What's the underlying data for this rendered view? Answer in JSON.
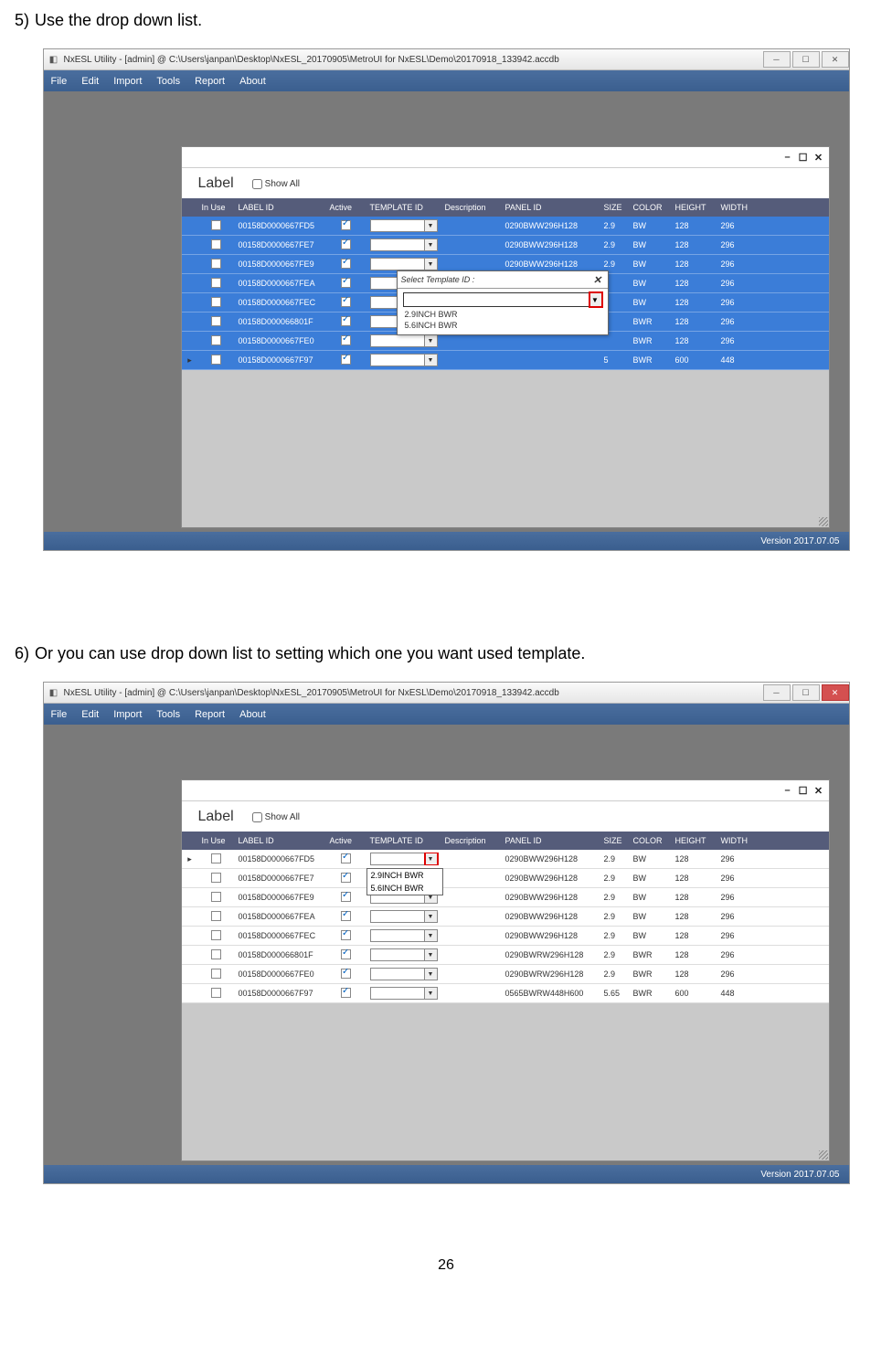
{
  "step5_text": "Use the drop down list.",
  "step5_num": "5)",
  "step6_text": "Or you can use drop down list to setting which one you want used template.",
  "step6_num": "6)",
  "page_number": "26",
  "app": {
    "title": "NxESL Utility - [admin] @ C:\\Users\\janpan\\Desktop\\NxESL_20170905\\MetroUI for NxESL\\Demo\\20170918_133942.accdb",
    "menu": [
      "File",
      "Edit",
      "Import",
      "Tools",
      "Report",
      "About"
    ],
    "version": "Version 2017.07.05"
  },
  "panel": {
    "label": "Label",
    "show_all": "Show All",
    "columns": [
      "",
      "In Use",
      "LABEL ID",
      "Active",
      "TEMPLATE ID",
      "Description",
      "PANEL ID",
      "SIZE",
      "COLOR",
      "HEIGHT",
      "WIDTH"
    ]
  },
  "rows1": [
    {
      "label": "00158D0000667FD5",
      "panel": "0290BWW296H128",
      "size": "2.9",
      "color": "BW",
      "h": "128",
      "w": "296"
    },
    {
      "label": "00158D0000667FE7",
      "panel": "0290BWW296H128",
      "size": "2.9",
      "color": "BW",
      "h": "128",
      "w": "296"
    },
    {
      "label": "00158D0000667FE9",
      "panel": "0290BWW296H128",
      "size": "2.9",
      "color": "BW",
      "h": "128",
      "w": "296"
    },
    {
      "label": "00158D0000667FEA",
      "panel": "",
      "size": "",
      "color": "BW",
      "h": "128",
      "w": "296"
    },
    {
      "label": "00158D0000667FEC",
      "panel": "",
      "size": "",
      "color": "BW",
      "h": "128",
      "w": "296"
    },
    {
      "label": "00158D000066801F",
      "panel": "",
      "size": "",
      "color": "BWR",
      "h": "128",
      "w": "296"
    },
    {
      "label": "00158D0000667FE0",
      "panel": "",
      "size": "",
      "color": "BWR",
      "h": "128",
      "w": "296"
    },
    {
      "label": "00158D0000667F97",
      "panel": "",
      "size": "5",
      "color": "BWR",
      "h": "600",
      "w": "448"
    }
  ],
  "dialog": {
    "title": "Select Template ID :",
    "options": [
      "2.9INCH BWR",
      "5.6INCH BWR"
    ]
  },
  "rows2": [
    {
      "label": "00158D0000667FD5",
      "panel": "0290BWW296H128",
      "size": "2.9",
      "color": "BW",
      "h": "128",
      "w": "296"
    },
    {
      "label": "00158D0000667FE7",
      "panel": "0290BWW296H128",
      "size": "2.9",
      "color": "BW",
      "h": "128",
      "w": "296"
    },
    {
      "label": "00158D0000667FE9",
      "panel": "0290BWW296H128",
      "size": "2.9",
      "color": "BW",
      "h": "128",
      "w": "296"
    },
    {
      "label": "00158D0000667FEA",
      "panel": "0290BWW296H128",
      "size": "2.9",
      "color": "BW",
      "h": "128",
      "w": "296"
    },
    {
      "label": "00158D0000667FEC",
      "panel": "0290BWW296H128",
      "size": "2.9",
      "color": "BW",
      "h": "128",
      "w": "296"
    },
    {
      "label": "00158D000066801F",
      "panel": "0290BWRW296H128",
      "size": "2.9",
      "color": "BWR",
      "h": "128",
      "w": "296"
    },
    {
      "label": "00158D0000667FE0",
      "panel": "0290BWRW296H128",
      "size": "2.9",
      "color": "BWR",
      "h": "128",
      "w": "296"
    },
    {
      "label": "00158D0000667F97",
      "panel": "0565BWRW448H600",
      "size": "5.65",
      "color": "BWR",
      "h": "600",
      "w": "448"
    }
  ],
  "inline_dd_options": [
    "2.9INCH BWR",
    "5.6INCH BWR"
  ]
}
